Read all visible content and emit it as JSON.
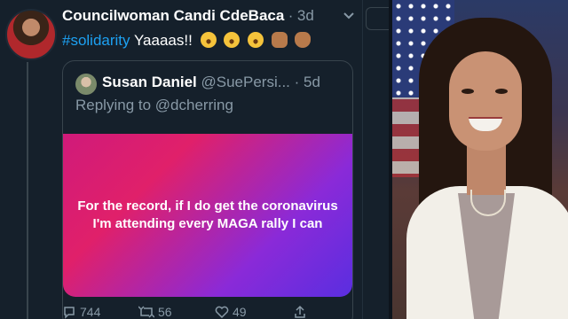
{
  "tweet": {
    "author_name": "Councilwoman Candi CdeBaca",
    "separator": "·",
    "time": "3d",
    "hashtag": "#solidarity",
    "text": " Yaaaas!!",
    "emojis": [
      "rolling-on-floor-laughing",
      "rolling-on-floor-laughing",
      "rolling-on-floor-laughing",
      "raised-fist",
      "ok-hand"
    ]
  },
  "quote": {
    "author_name": "Susan Daniel",
    "handle": "@SuePersi...",
    "separator": "·",
    "time": "5d",
    "reply_prefix": "Replying to ",
    "reply_mention": "@dcherring",
    "image_text": "For the record, if I do get the coronavirus I'm attending every MAGA rally I can"
  },
  "actions": {
    "replies": "744",
    "retweets": "56",
    "likes": "49"
  },
  "colors": {
    "background": "#15202b",
    "text_primary": "#ffffff",
    "text_secondary": "#8899a6",
    "link": "#1da1f2",
    "border": "#38444d"
  },
  "icons": [
    "chevron-down-icon",
    "reply-icon",
    "retweet-icon",
    "like-icon",
    "share-icon"
  ]
}
